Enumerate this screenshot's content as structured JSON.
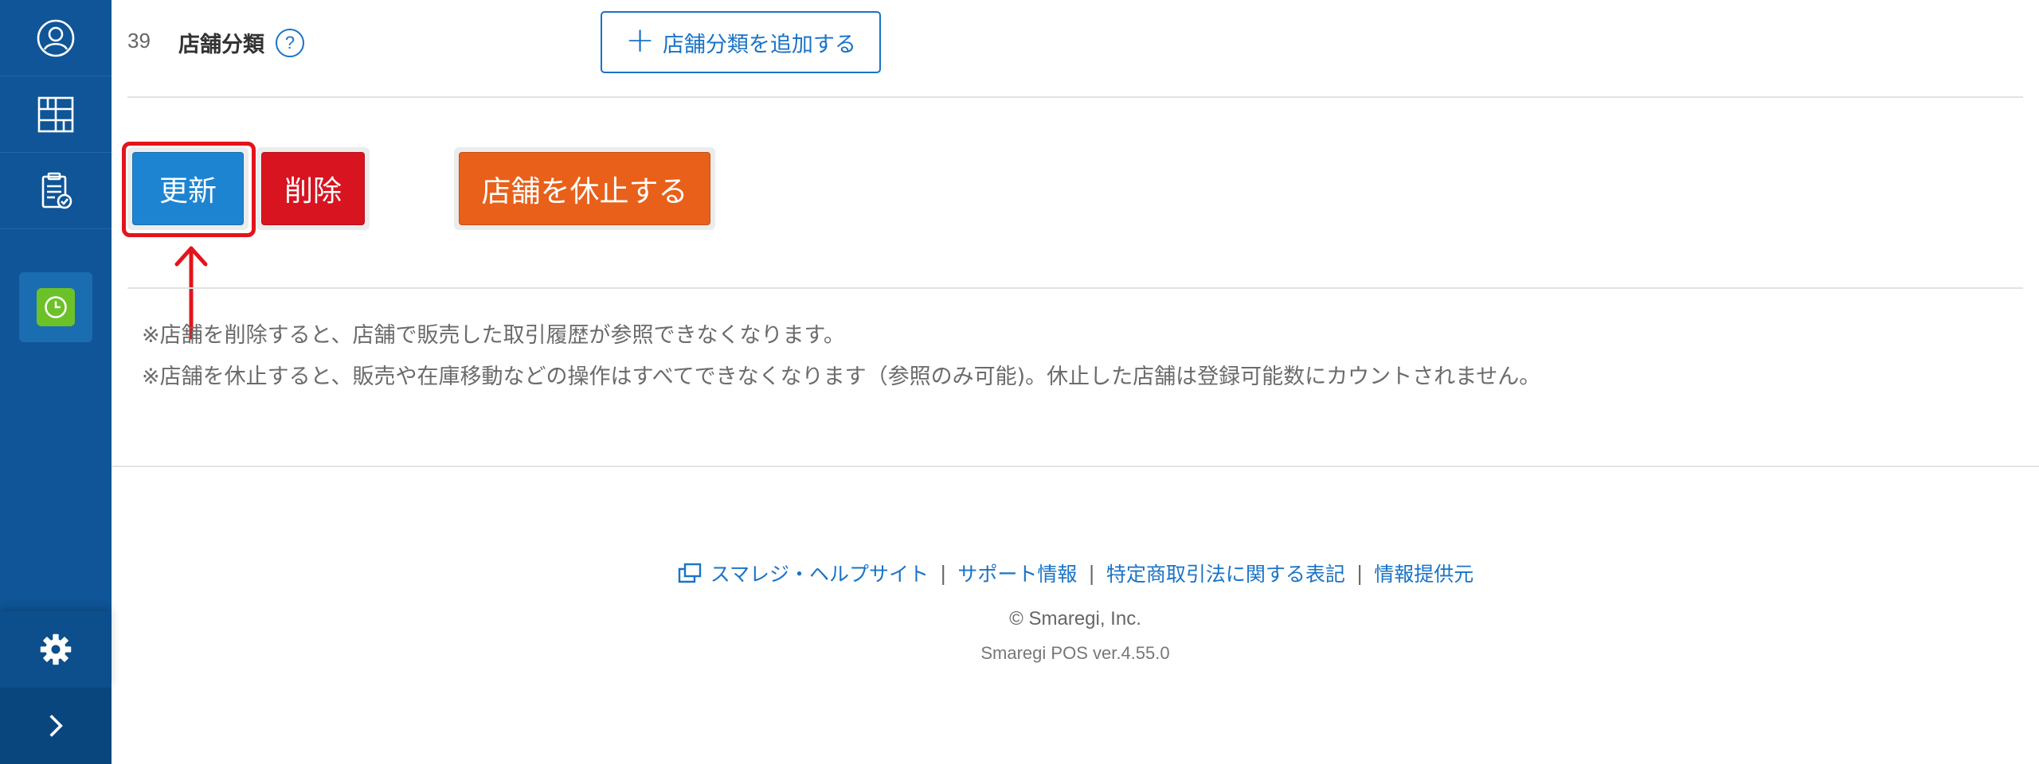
{
  "sidebar": {
    "items": [
      {
        "icon": "user-icon"
      },
      {
        "icon": "grid-icon"
      },
      {
        "icon": "clipboard-icon"
      },
      {
        "icon": "clock-icon",
        "active": true
      }
    ],
    "settings_icon": "gear-icon",
    "expand_icon": "chevron-right-icon"
  },
  "field": {
    "row_number": "39",
    "label": "店舗分類",
    "help_glyph": "?",
    "add_button": "店舗分類を追加する"
  },
  "actions": {
    "update": "更新",
    "delete": "削除",
    "suspend": "店舗を休止する"
  },
  "notes": [
    "※店舗を削除すると、店舗で販売した取引履歴が参照できなくなります。",
    "※店舗を休止すると、販売や在庫移動などの操作はすべてできなくなります（参照のみ可能)。休止した店舗は登録可能数にカウントされません。"
  ],
  "footer": {
    "links": [
      "スマレジ・ヘルプサイト",
      "サポート情報",
      "特定商取引法に関する表記",
      "情報提供元"
    ],
    "separator": "|",
    "copyright": "© Smaregi, Inc.",
    "version": "Smaregi POS ver.4.55.0"
  },
  "colors": {
    "sidebar": "#0f5597",
    "accent": "#1a73c7",
    "update": "#1d84d2",
    "delete": "#d7141f",
    "suspend": "#e8601a",
    "highlight": "#e3141c",
    "clock": "#6cc129"
  }
}
